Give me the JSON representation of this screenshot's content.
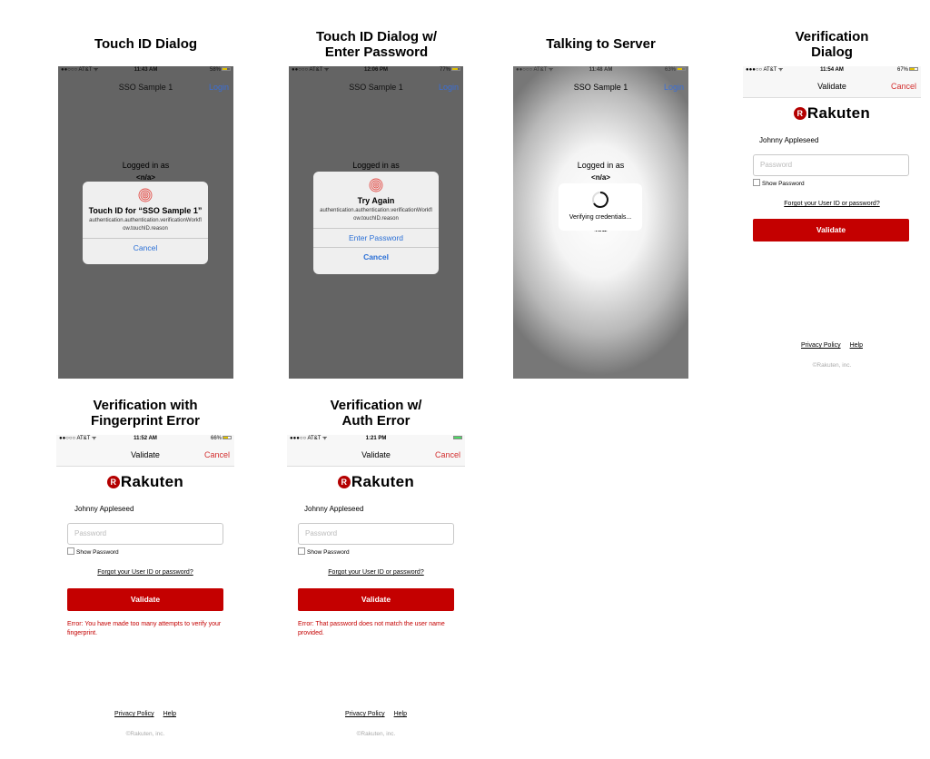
{
  "screens": {
    "touch_id": {
      "title_line1": "Touch ID Dialog",
      "carrier": "●●○○○ AT&T ᯤ",
      "time": "11:43 AM",
      "battery": "58%",
      "nav_title": "SSO Sample 1",
      "nav_right": "Login",
      "logged_in": "Logged in as",
      "user_value": "<n/a>",
      "alert_title": "Touch ID for “SSO Sample 1”",
      "alert_message": "authentication.authentication.verificationWorkflow.touchID.reason",
      "cancel": "Cancel"
    },
    "touch_id_pw": {
      "title_line1": "Touch ID Dialog w/",
      "title_line2": "Enter Password",
      "carrier": "●●○○○ AT&T ᯤ",
      "time": "12:06 PM",
      "battery": "77%",
      "nav_title": "SSO Sample 1",
      "nav_right": "Login",
      "logged_in": "Logged in as",
      "alert_title": "Try Again",
      "alert_message": "authentication.authentication.verificationWorkflow.touchID.reason",
      "enter_password": "Enter Password",
      "cancel": "Cancel"
    },
    "server": {
      "title_line1": "Talking to Server",
      "carrier": "●●○○○ AT&T ᯤ",
      "time": "11:48 AM",
      "battery": "63%",
      "nav_title": "SSO Sample 1",
      "nav_right": "Login",
      "logged_in": "Logged in as",
      "user_value": "<n/a>",
      "user_value_partial": "<n/a>",
      "spinner_msg": "Verifying credentials..."
    },
    "verification": {
      "title_line1": "Verification",
      "title_line2": "Dialog",
      "carrier": "●●●○○ AT&T ᯤ",
      "time": "11:54 AM",
      "battery": "67%",
      "nav_title": "Validate",
      "nav_right": "Cancel",
      "logo": "Rakuten",
      "logo_mark": "R",
      "user_name": "Johnny Appleseed",
      "password_placeholder": "Password",
      "show_password": "Show Password",
      "forgot": "Forgot your User ID or password?",
      "validate": "Validate",
      "privacy": "Privacy Policy",
      "help": "Help",
      "copyright": "©Rakuten, inc."
    },
    "fp_error": {
      "title_line1": "Verification with",
      "title_line2": "Fingerprint Error",
      "carrier": "●●○○○ AT&T ᯤ",
      "time": "11:52 AM",
      "battery": "66%",
      "nav_title": "Validate",
      "nav_right": "Cancel",
      "logo": "Rakuten",
      "logo_mark": "R",
      "user_name": "Johnny Appleseed",
      "password_placeholder": "Password",
      "show_password": "Show Password",
      "forgot": "Forgot your User ID or password?",
      "validate": "Validate",
      "error": "Error: You have made too many attempts to verify your fingerprint.",
      "privacy": "Privacy Policy",
      "help": "Help",
      "copyright": "©Rakuten, inc."
    },
    "auth_error": {
      "title_line1": "Verification w/",
      "title_line2": "Auth Error",
      "carrier": "●●●○○ AT&T ᯤ",
      "time": "1:21 PM",
      "battery": "",
      "nav_title": "Validate",
      "nav_right": "Cancel",
      "logo": "Rakuten",
      "logo_mark": "R",
      "user_name": "Johnny Appleseed",
      "password_placeholder": "Password",
      "show_password": "Show Password",
      "forgot": "Forgot your User ID or password?",
      "validate": "Validate",
      "error": "Error: That password does not match the user name provided.",
      "privacy": "Privacy Policy",
      "help": "Help",
      "copyright": "©Rakuten, inc."
    }
  },
  "colors": {
    "brand_red": "#c40000",
    "link_blue": "#2a6fd6",
    "dim_overlay": "#646464"
  }
}
